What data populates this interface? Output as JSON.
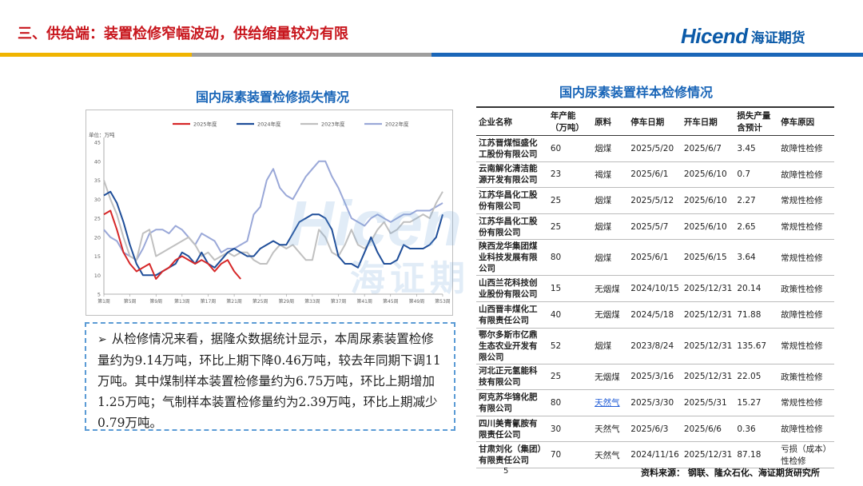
{
  "header": {
    "title": "三、供给端：装置检修窄幅波动，供给缩量较为有限",
    "logo_en": "Hicend",
    "logo_cn": "海证期货",
    "bar_colors": [
      "#f0b400",
      "#9e9e9e",
      "#1a66b8"
    ]
  },
  "watermark": {
    "en": "Hicen",
    "cn": "海证期"
  },
  "chart_section": {
    "title": "国内尿素装置检修损失情况"
  },
  "chart_data": {
    "type": "line",
    "title": "",
    "unit_label": "单位：万吨",
    "ylim": [
      5,
      45
    ],
    "yticks": [
      5,
      10,
      15,
      20,
      25,
      30,
      35,
      40,
      45
    ],
    "xlim": [
      1,
      53
    ],
    "xticks": [
      1,
      5,
      9,
      13,
      17,
      21,
      25,
      29,
      33,
      37,
      41,
      45,
      49,
      53
    ],
    "xtick_labels": [
      "第1周",
      "第5周",
      "第9周",
      "第13周",
      "第17周",
      "第21周",
      "第25周",
      "第29周",
      "第33周",
      "第37周",
      "第41周",
      "第45周",
      "第49周",
      "第53周"
    ],
    "legend_position": "top",
    "series": [
      {
        "name": "2025年度",
        "color": "#d62728",
        "width": 2,
        "x": [
          1,
          2,
          3,
          4,
          5,
          6,
          7,
          8,
          9,
          10,
          11,
          12,
          13,
          14,
          15,
          16,
          17,
          18,
          19,
          20,
          21,
          22
        ],
        "y": [
          26,
          27,
          22,
          16,
          13,
          11,
          12,
          13,
          9,
          11,
          12,
          14,
          15,
          14,
          13,
          14,
          13,
          11,
          13,
          14,
          11,
          9
        ]
      },
      {
        "name": "2024年度",
        "color": "#1f4e99",
        "width": 2,
        "x": [
          1,
          2,
          3,
          4,
          5,
          6,
          7,
          8,
          9,
          10,
          11,
          12,
          13,
          14,
          15,
          16,
          17,
          18,
          19,
          20,
          21,
          22,
          23,
          24,
          25,
          26,
          27,
          28,
          29,
          30,
          31,
          32,
          33,
          34,
          35,
          36,
          37,
          38,
          39,
          40,
          41,
          42,
          43,
          44,
          45,
          46,
          47,
          48,
          49,
          50,
          51,
          52,
          53
        ],
        "y": [
          31,
          32,
          29,
          24,
          18,
          13,
          10,
          10,
          10,
          11,
          12,
          13,
          16,
          15,
          13,
          16,
          13,
          12,
          14,
          16,
          17,
          16,
          15,
          15,
          17,
          18,
          19,
          18,
          18,
          21,
          24,
          25,
          26,
          26,
          25,
          22,
          15,
          13,
          13,
          12,
          16,
          20,
          16,
          13,
          13,
          14,
          18,
          17,
          17,
          17,
          18,
          20,
          26
        ]
      },
      {
        "name": "2023年度",
        "color": "#c0c0c0",
        "width": 2,
        "x": [
          1,
          2,
          3,
          4,
          5,
          6,
          7,
          8,
          9,
          10,
          11,
          12,
          13,
          14,
          15,
          16,
          17,
          18,
          19,
          20,
          21,
          22,
          23,
          24,
          25,
          26,
          27,
          28,
          29,
          30,
          31,
          32,
          33,
          34,
          35,
          36,
          37,
          38,
          39,
          40,
          41,
          42,
          43,
          44,
          45,
          46,
          47,
          48,
          49,
          50,
          51,
          52,
          53
        ],
        "y": [
          35,
          30,
          26,
          20,
          15,
          14,
          21,
          22,
          15,
          16,
          17,
          18,
          19,
          20,
          18,
          15,
          16,
          14,
          15,
          16,
          15,
          16,
          16,
          14,
          13,
          13,
          16,
          18,
          17,
          18,
          16,
          14,
          14,
          22,
          20,
          16,
          15,
          18,
          22,
          18,
          17,
          19,
          22,
          24,
          21,
          22,
          24,
          24,
          25,
          26,
          25,
          29,
          32
        ]
      },
      {
        "name": "2022年度",
        "color": "#9aa8d8",
        "width": 2,
        "x": [
          1,
          2,
          3,
          4,
          5,
          6,
          7,
          8,
          9,
          10,
          11,
          12,
          13,
          14,
          15,
          16,
          17,
          18,
          19,
          20,
          21,
          22,
          23,
          24,
          25,
          26,
          27,
          28,
          29,
          30,
          31,
          32,
          33,
          34,
          35,
          36,
          37,
          38,
          39,
          40,
          41,
          42,
          43,
          44,
          45,
          46,
          47,
          48,
          49,
          50,
          51,
          52,
          53
        ],
        "y": [
          22,
          20,
          19,
          16,
          15,
          14,
          17,
          21,
          22,
          22,
          21,
          23,
          22,
          20,
          18,
          21,
          20,
          19,
          16,
          17,
          17,
          18,
          19,
          26,
          28,
          35,
          38,
          33,
          31,
          30,
          33,
          36,
          38,
          40,
          40,
          36,
          33,
          29,
          25,
          24,
          23,
          25,
          26,
          25,
          24,
          25,
          26,
          26,
          27,
          27,
          27,
          28,
          29
        ]
      }
    ]
  },
  "summary": {
    "bullet": "➢",
    "text": "从检修情况来看，据隆众数据统计显示，本周尿素装置检修量约为9.14万吨，环比上期下降0.46万吨，较去年同期下调11万吨。其中煤制样本装置检修量约为6.75万吨，环比上期增加1.25万吨；气制样本装置检修量约为2.39万吨，环比上期减少0.79万吨。"
  },
  "table_section": {
    "title": "国内尿素装置样本检修情况",
    "headers": [
      "企业名称",
      "年产能（万吨）",
      "原料",
      "停车日期",
      "开车日期",
      "损失产量含预计",
      "停车原因"
    ],
    "rows": [
      [
        "江苏晋煤恒盛化工股份有限公司",
        "60",
        "烟煤",
        "2025/5/20",
        "2025/6/7",
        "3.45",
        "故障性检修"
      ],
      [
        "云南解化清洁能源开发有限公司",
        "23",
        "褐煤",
        "2025/6/1",
        "2025/6/10",
        "0.7",
        "故障性检修"
      ],
      [
        "江苏华昌化工股份有限公司",
        "25",
        "烟煤",
        "2025/5/12",
        "2025/6/10",
        "2.27",
        "常规性检修"
      ],
      [
        "江苏华昌化工股份有限公司",
        "25",
        "烟煤",
        "2025/5/7",
        "2025/6/10",
        "2.65",
        "常规性检修"
      ],
      [
        "陕西龙华集团煤业科技发展有限公司",
        "80",
        "烟煤",
        "2025/6/1",
        "2025/6/15",
        "3.64",
        "常规性检修"
      ],
      [
        "山西兰花科技创业股份有限公司",
        "15",
        "无烟煤",
        "2024/10/15",
        "2025/12/31",
        "20.14",
        "政策性检修"
      ],
      [
        "山西晋丰煤化工有限责任公司",
        "40",
        "无烟煤",
        "2024/5/18",
        "2025/12/31",
        "71.88",
        "故障性检修"
      ],
      [
        "鄂尔多斯市亿鼎生态农业开发有限公司",
        "52",
        "烟煤",
        "2023/8/24",
        "2025/12/31",
        "135.67",
        "常规性检修"
      ],
      [
        "河北正元氢能科技有限公司",
        "25",
        "无烟煤",
        "2025/3/16",
        "2025/12/31",
        "22.05",
        "政策性检修"
      ],
      [
        "阿克苏华锦化肥有限公司",
        "80",
        "天然气",
        "2025/3/30",
        "2025/5/31",
        "15.27",
        "常规性检修"
      ],
      [
        "四川美青氰胺有限责任公司",
        "30",
        "天然气",
        "2025/6/3",
        "2025/6/6",
        "0.36",
        "故障性检修"
      ],
      [
        "甘肃刘化（集团）有限责任公司",
        "70",
        "天然气",
        "2024/11/16",
        "2025/12/31",
        "87.18",
        "亏损（成本）性检修"
      ]
    ]
  },
  "footer": {
    "page_number": "5",
    "source": "资料来源：  钢联、隆众石化、海证期货研究所"
  }
}
